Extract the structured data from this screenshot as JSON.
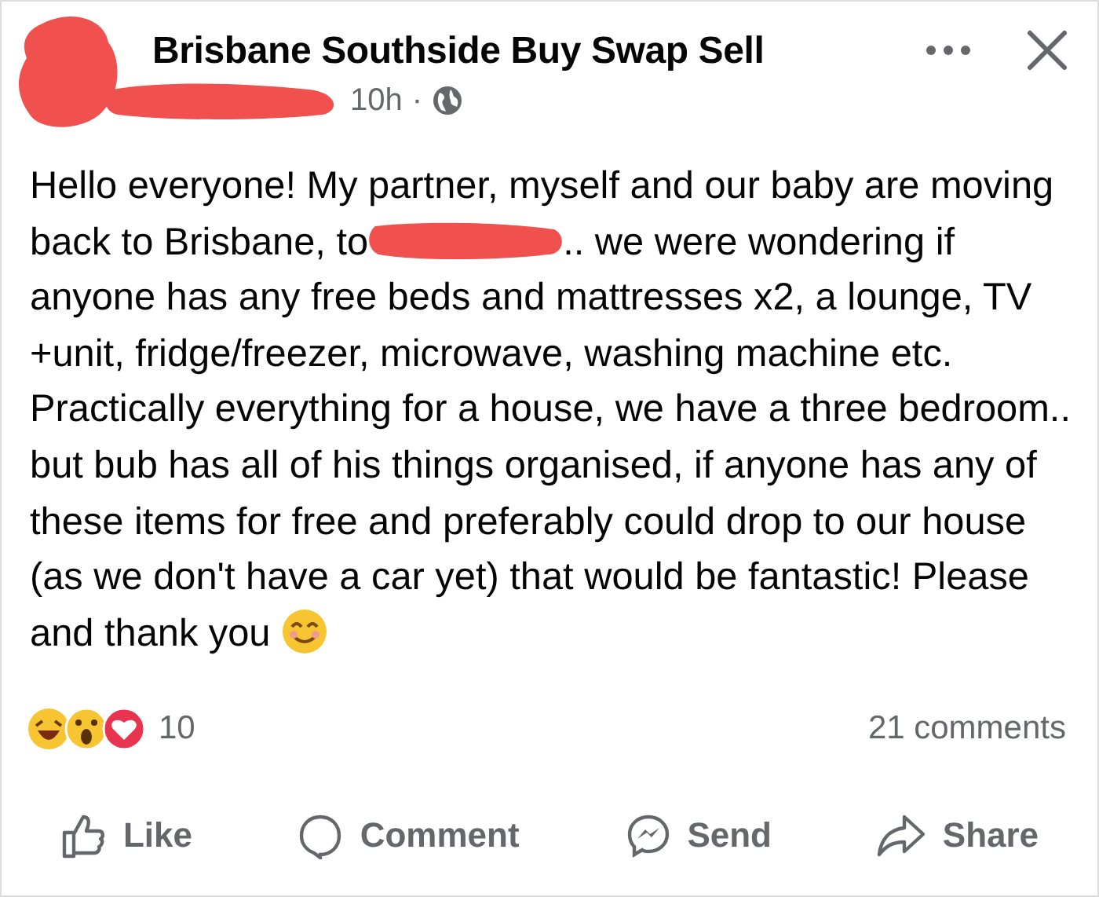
{
  "post": {
    "group": "Brisbane Southside Buy Swap Sell",
    "time": "10h",
    "separator": "·",
    "body_before": "Hello everyone! My partner, myself and our baby are moving back to Brisbane, to",
    "body_after": ".. we were wondering if anyone has any free beds and mattresses x2, a lounge, TV +unit, fridge/freezer, microwave, washing machine etc. Practically everything for a house, we have a three bedroom.. but bub has all of his things organised, if anyone has any of these items for free and preferably could drop to our house (as we don't have a car yet) that would be fantastic! Please and thank you"
  },
  "reactions": {
    "count": "10",
    "comments": "21 comments"
  },
  "actions": [
    {
      "kind": "like",
      "label": "Like"
    },
    {
      "kind": "comment",
      "label": "Comment"
    },
    {
      "kind": "send",
      "label": "Send"
    },
    {
      "kind": "share",
      "label": "Share"
    }
  ]
}
